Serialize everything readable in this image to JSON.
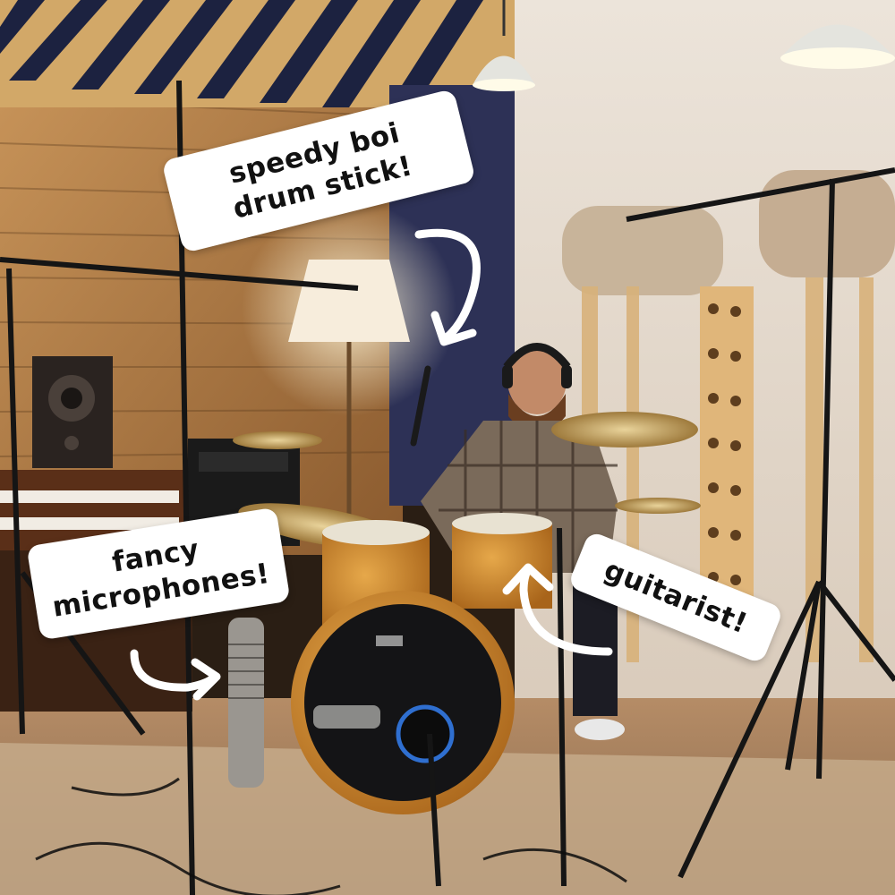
{
  "annotations": {
    "drumstick": "speedy boi drum stick!",
    "microphones": "fancy microphones!",
    "guitarist": "guitarist!"
  },
  "colors": {
    "label_bg": "#ffffff",
    "label_text": "#111111",
    "arrow": "#ffffff",
    "drum_shell": "#c8862c",
    "back_wall_blue": "#2d3156"
  }
}
